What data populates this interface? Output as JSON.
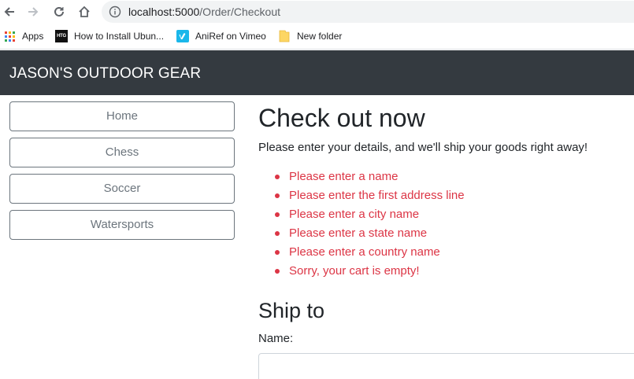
{
  "browser": {
    "url_host": "localhost:5000",
    "url_path": "/Order/Checkout",
    "bookmarks": [
      {
        "label": "Apps",
        "icon": "apps-grid-icon"
      },
      {
        "label": "How to Install Ubun...",
        "icon": "htg-icon"
      },
      {
        "label": "AniRef on Vimeo",
        "icon": "vimeo-icon"
      },
      {
        "label": "New folder",
        "icon": "folder-icon"
      }
    ],
    "htg_icon_text": "HTG"
  },
  "header": {
    "brand": "JASON'S OUTDOOR GEAR"
  },
  "sidebar": {
    "categories": [
      {
        "label": "Home"
      },
      {
        "label": "Chess"
      },
      {
        "label": "Soccer"
      },
      {
        "label": "Watersports"
      }
    ]
  },
  "main": {
    "title": "Check out now",
    "lead": "Please enter your details, and we'll ship your goods right away!",
    "errors": [
      "Please enter a name",
      "Please enter the first address line",
      "Please enter a city name",
      "Please enter a state name",
      "Please enter a country name",
      "Sorry, your cart is empty!"
    ],
    "ship_to_heading": "Ship to",
    "name_label": "Name:",
    "name_value": ""
  },
  "colors": {
    "header_bg": "#343a40",
    "error": "#dc3545",
    "secondary": "#6c757d"
  }
}
